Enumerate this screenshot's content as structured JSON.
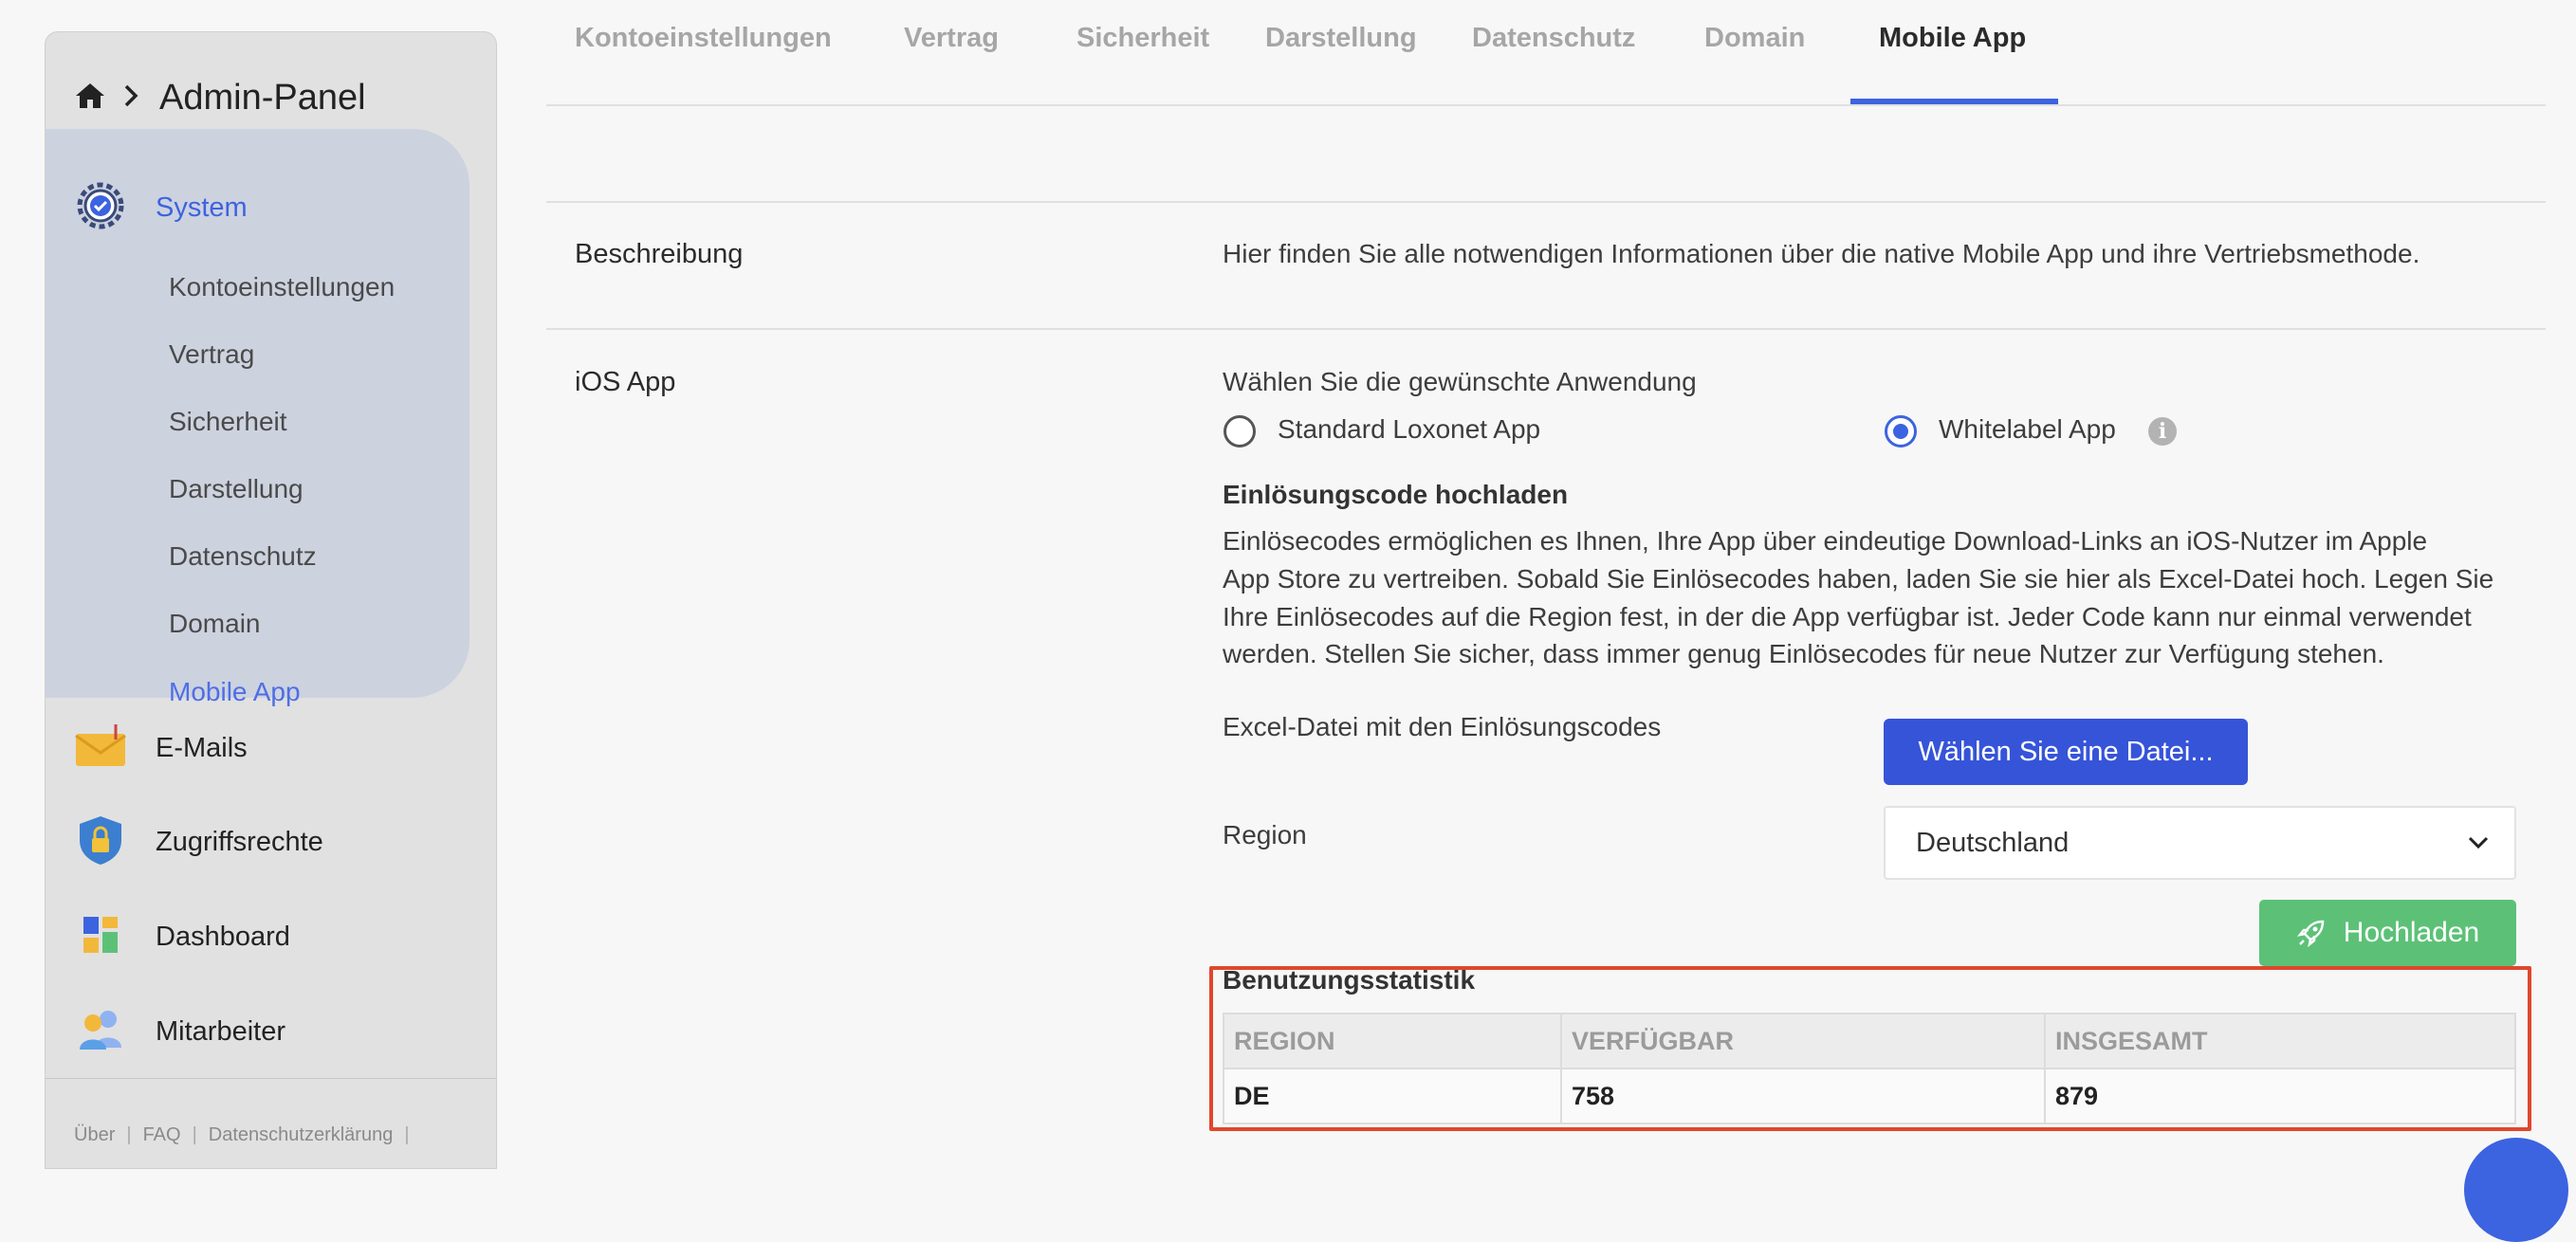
{
  "breadcrumb": {
    "title": "Admin-Panel"
  },
  "sidebar": {
    "system_label": "System",
    "sub_items": [
      "Kontoeinstellungen",
      "Vertrag",
      "Sicherheit",
      "Darstellung",
      "Datenschutz",
      "Domain",
      "Mobile App"
    ],
    "active_sub": "Mobile App",
    "items": [
      {
        "label": "E-Mails",
        "icon": "envelope-icon"
      },
      {
        "label": "Zugriffsrechte",
        "icon": "shield-lock-icon"
      },
      {
        "label": "Dashboard",
        "icon": "dashboard-icon"
      },
      {
        "label": "Mitarbeiter",
        "icon": "users-icon"
      }
    ],
    "footer": [
      "Über",
      "FAQ",
      "Datenschutzerklärung"
    ]
  },
  "tabs": [
    "Kontoeinstellungen",
    "Vertrag",
    "Sicherheit",
    "Darstellung",
    "Datenschutz",
    "Domain",
    "Mobile App"
  ],
  "active_tab": "Mobile App",
  "description": {
    "label": "Beschreibung",
    "text": "Hier finden Sie alle notwendigen Informationen über die native Mobile App und ihre Vertriebsmethode."
  },
  "ios": {
    "label": "iOS App",
    "choose_text": "Wählen Sie die gewünschte Anwendung",
    "option_standard": "Standard Loxonet App",
    "option_whitelabel": "Whitelabel App",
    "selected": "Whitelabel App",
    "redeem_title": "Einlösungscode hochladen",
    "redeem_paragraph": [
      "Einlösecodes ermöglichen es Ihnen, Ihre App über eindeutige Download-Links an iOS-Nutzer im Apple",
      "App Store zu vertreiben. Sobald Sie Einlösecodes haben, laden Sie sie hier als Excel-Datei hoch. Legen Sie",
      "Ihre Einlösecodes auf die Region fest, in der die App verfügbar ist. Jeder Code kann nur einmal verwendet",
      "werden. Stellen Sie sicher, dass immer genug Einlösecodes für neue Nutzer zur Verfügung stehen."
    ],
    "file_label": "Excel-Datei mit den Einlösungscodes",
    "file_button": "Wählen Sie eine Datei...",
    "region_label": "Region",
    "region_value": "Deutschland",
    "upload_button": "Hochladen"
  },
  "stats": {
    "title": "Benutzungsstatistik",
    "columns": [
      "REGION",
      "VERFÜGBAR",
      "INSGESAMT"
    ],
    "rows": [
      [
        "DE",
        "758",
        "879"
      ]
    ]
  },
  "colors": {
    "accent": "#3c63e0",
    "success": "#5cc177",
    "highlight": "#e0472c"
  }
}
